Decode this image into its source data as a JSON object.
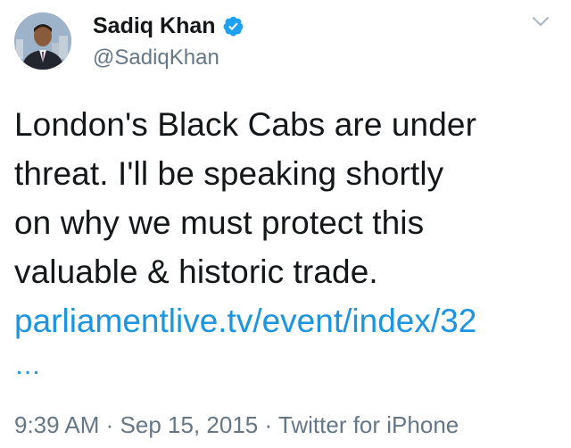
{
  "author": {
    "name": "Sadiq Khan",
    "handle": "@SadiqKhan",
    "verified": true
  },
  "tweet": {
    "text": "London's Black Cabs are under\nthreat. I'll be speaking shortly\non why we must protect this\nvaluable & historic trade.",
    "link": "parliamentlive.tv/event/index/32",
    "truncation": "…",
    "time": "9:39 AM",
    "date": "Sep 15, 2015",
    "source": "Twitter for iPhone",
    "separator": "·"
  },
  "icons": {
    "verified": "verified-badge-icon",
    "menu": "chevron-down-icon"
  },
  "colors": {
    "text": "#14171a",
    "secondary": "#657786",
    "link": "#1b95e0",
    "verified": "#1da1f2"
  }
}
